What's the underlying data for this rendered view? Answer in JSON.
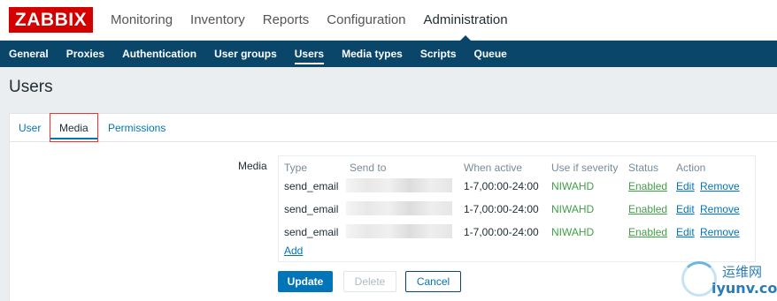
{
  "logo": "ZABBIX",
  "main_menu": [
    "Monitoring",
    "Inventory",
    "Reports",
    "Configuration",
    "Administration"
  ],
  "main_menu_active": "Administration",
  "sub_menu": [
    "General",
    "Proxies",
    "Authentication",
    "User groups",
    "Users",
    "Media types",
    "Scripts",
    "Queue"
  ],
  "sub_menu_active": "Users",
  "page_title": "Users",
  "tabs": [
    "User",
    "Media",
    "Permissions"
  ],
  "active_tab": "Media",
  "media": {
    "label": "Media",
    "headers": [
      "Type",
      "Send to",
      "When active",
      "Use if severity",
      "Status",
      "Action"
    ],
    "rows": [
      {
        "type": "send_email",
        "when_active": "1-7,00:00-24:00",
        "severity": "NIWAHD",
        "status": "Enabled",
        "edit": "Edit",
        "remove": "Remove"
      },
      {
        "type": "send_email",
        "when_active": "1-7,00:00-24:00",
        "severity": "NIWAHD",
        "status": "Enabled",
        "edit": "Edit",
        "remove": "Remove"
      },
      {
        "type": "send_email",
        "when_active": "1-7,00:00-24:00",
        "severity": "NIWAHD",
        "status": "Enabled",
        "edit": "Edit",
        "remove": "Remove"
      }
    ],
    "add_label": "Add"
  },
  "buttons": {
    "update": "Update",
    "delete": "Delete",
    "cancel": "Cancel"
  },
  "watermark": {
    "line1": "运维网",
    "line2": "iyunv.com"
  },
  "colors": {
    "brand": "#d40000",
    "nav": "#0a466a",
    "link": "#0275b8",
    "enabled": "#429e47"
  }
}
